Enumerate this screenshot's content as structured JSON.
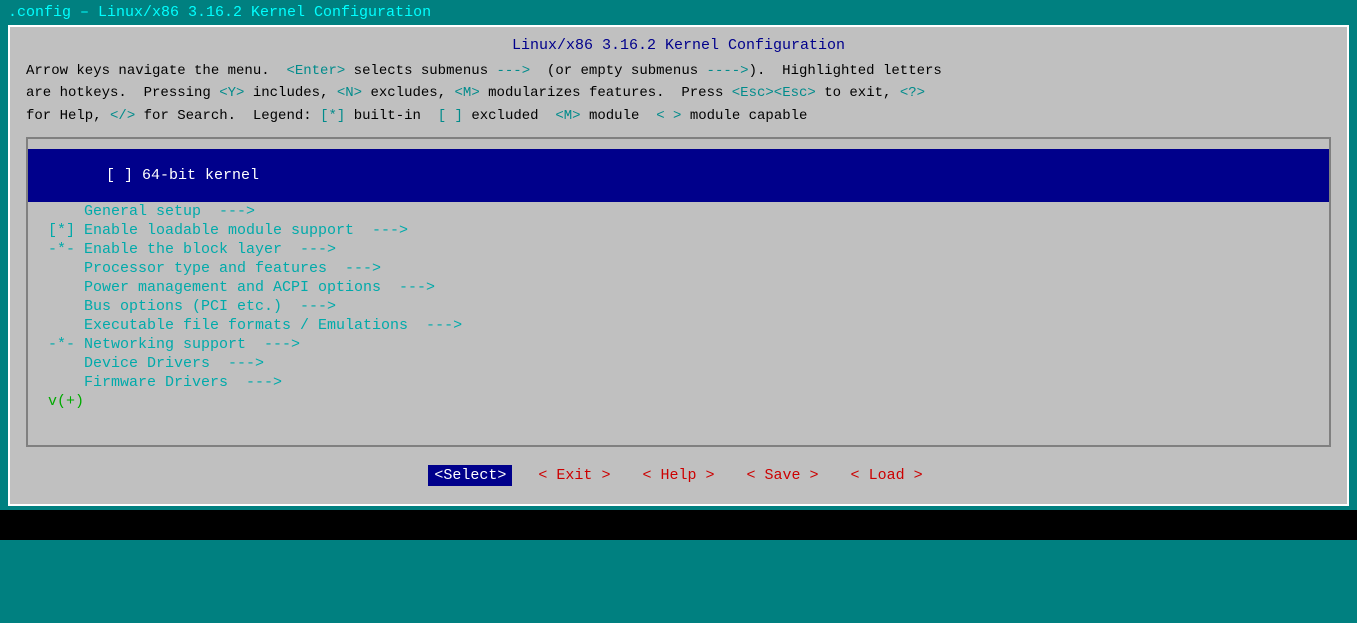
{
  "titleBar": {
    "text": ".config – Linux/x86 3.16.2 Kernel Configuration"
  },
  "header": {
    "title": "Linux/x86 3.16.2 Kernel Configuration",
    "helpLine1": "Arrow keys navigate the menu.  <Enter> selects submenus --->  (or empty submenus ---->).  Highlighted letters",
    "helpLine2": "are hotkeys.  Pressing <Y> includes, <N> excludes, <M> modularizes features.  Press <Esc><Esc> to exit, <?>",
    "helpLine3": "for Help, </> for Search.  Legend: [*] built-in  [ ] excluded  <M> module  < > module capable"
  },
  "menu": {
    "items": [
      {
        "id": "64bit-kernel",
        "label": "[ ] 64-bit kernel",
        "selected": true
      },
      {
        "id": "general-setup",
        "label": "    General setup  --->",
        "selected": false
      },
      {
        "id": "loadable-module",
        "label": "[*] Enable loadable module support  --->",
        "selected": false
      },
      {
        "id": "block-layer",
        "label": "-*- Enable the block layer  --->",
        "selected": false
      },
      {
        "id": "processor-type",
        "label": "    Processor type and features  --->",
        "selected": false
      },
      {
        "id": "power-management",
        "label": "    Power management and ACPI options  --->",
        "selected": false
      },
      {
        "id": "bus-options",
        "label": "    Bus options (PCI etc.)  --->",
        "selected": false
      },
      {
        "id": "executable-formats",
        "label": "    Executable file formats / Emulations  --->",
        "selected": false
      },
      {
        "id": "networking",
        "label": "-*- Networking support  --->",
        "selected": false
      },
      {
        "id": "device-drivers",
        "label": "    Device Drivers  --->",
        "selected": false
      },
      {
        "id": "firmware-drivers",
        "label": "    Firmware Drivers  --->",
        "selected": false
      }
    ],
    "scrollIndicator": "v(+)"
  },
  "buttons": [
    {
      "id": "select",
      "label": "Select",
      "selected": true
    },
    {
      "id": "exit",
      "label": "Exit",
      "selected": false
    },
    {
      "id": "help",
      "label": "Help",
      "selected": false
    },
    {
      "id": "save",
      "label": "Save",
      "selected": false
    },
    {
      "id": "load",
      "label": "Load",
      "selected": false
    }
  ]
}
